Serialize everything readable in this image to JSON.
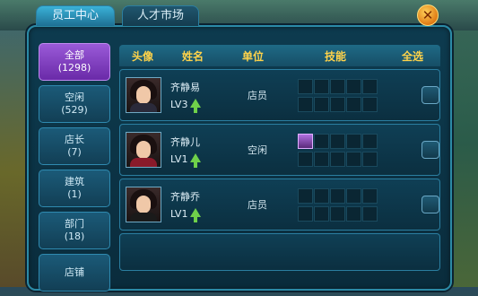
{
  "tabs": {
    "active": "员工中心",
    "inactive": "人才市场"
  },
  "sidebar": {
    "items": [
      {
        "label": "全部",
        "count": "(1298)"
      },
      {
        "label": "空闲",
        "count": "(529)"
      },
      {
        "label": "店长",
        "count": "(7)"
      },
      {
        "label": "建筑",
        "count": "(1)"
      },
      {
        "label": "部门",
        "count": "(18)"
      },
      {
        "label": "店铺",
        "count": ""
      }
    ]
  },
  "table": {
    "headers": [
      "头像",
      "姓名",
      "单位",
      "技能",
      "全选"
    ],
    "rows": [
      {
        "name": "齐静易",
        "level": "LV3",
        "unit": "店员",
        "skill_item": false
      },
      {
        "name": "齐静儿",
        "level": "LV1",
        "unit": "空闲",
        "skill_item": true
      },
      {
        "name": "齐静乔",
        "level": "LV1",
        "unit": "店员",
        "skill_item": false
      }
    ]
  },
  "icons": {
    "close": "close-icon",
    "level_up": "up-arrow-icon"
  }
}
